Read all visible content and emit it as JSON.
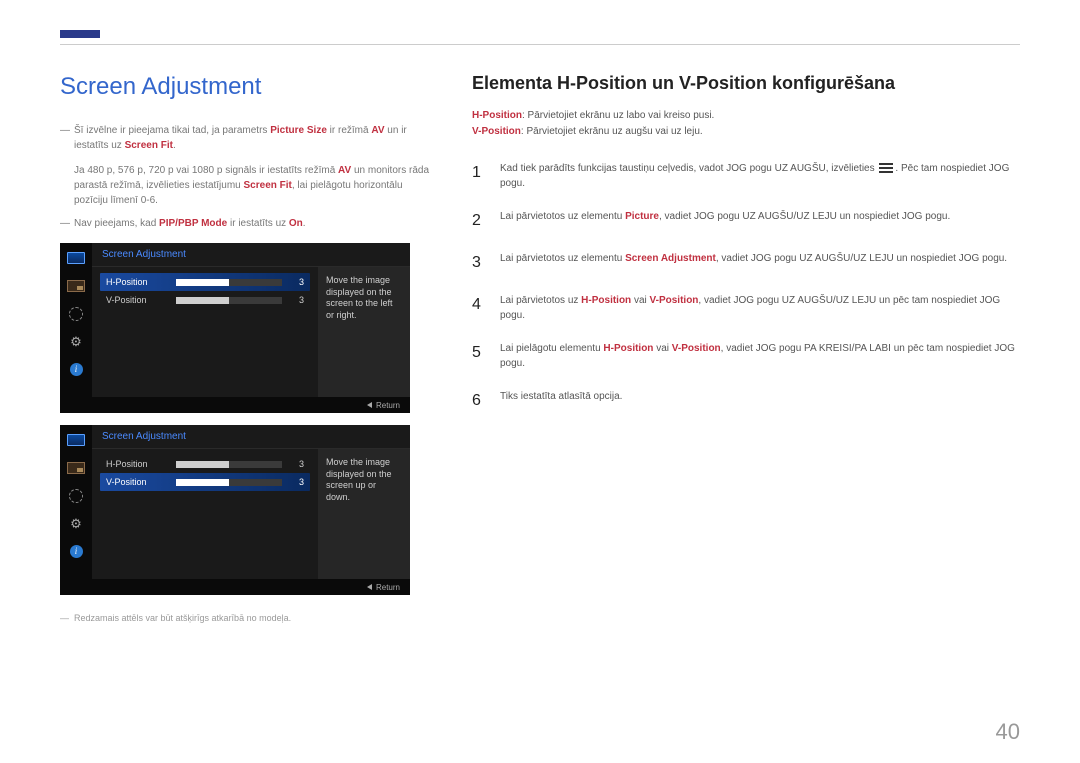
{
  "page_number": "40",
  "left": {
    "title": "Screen Adjustment",
    "note1_pre": "Šī izvēlne ir pieejama tikai tad, ja parametrs ",
    "note1_hl1": "Picture Size",
    "note1_mid": " ir režīmā ",
    "note1_hl2": "AV",
    "note1_mid2": " un ir iestatīts uz ",
    "note1_hl3": "Screen Fit",
    "note1b_pre": "Ja 480 p, 576 p, 720 p vai 1080 p signāls ir iestatīts režīmā ",
    "note1b_hl": "AV",
    "note1b_mid": " un monitors rāda parastā režīmā, izvēlieties iestatījumu ",
    "note1b_hl2": "Screen Fit",
    "note1b_post": ", lai pielāgotu horizontālu pozīciju līmenī 0-6.",
    "note2_pre": "Nav pieejams, kad ",
    "note2_hl": "PIP/PBP Mode",
    "note2_mid": " ir iestatīts uz ",
    "note2_hl2": "On",
    "footnote": "Redzamais attēls var būt atšķirīgs atkarībā no modeļa."
  },
  "osd1": {
    "header": "Screen Adjustment",
    "row1_label": "H-Position",
    "row1_val": "3",
    "row2_label": "V-Position",
    "row2_val": "3",
    "hint": "Move the image displayed on the screen to the left or right.",
    "return": "Return"
  },
  "osd2": {
    "header": "Screen Adjustment",
    "row1_label": "H-Position",
    "row1_val": "3",
    "row2_label": "V-Position",
    "row2_val": "3",
    "hint": "Move the image displayed on the screen up or down.",
    "return": "Return"
  },
  "right": {
    "heading": "Elementa H-Position un V-Position konfigurēšana",
    "desc1_lbl": "H-Position",
    "desc1_txt": ": Pārvietojiet ekrānu uz labo vai kreiso pusi.",
    "desc2_lbl": "V-Position",
    "desc2_txt": ": Pārvietojiet ekrānu uz augšu vai uz leju.",
    "steps": {
      "1_a": "Kad tiek parādīts funkcijas taustiņu ceļvedis, vadot JOG pogu UZ AUGŠU, izvēlieties ",
      "1_c": ". Pēc tam nospiediet JOG pogu.",
      "2_a": "Lai pārvietotos uz elementu ",
      "2_hl": "Picture",
      "2_b": ", vadiet JOG pogu UZ AUGŠU/UZ LEJU un nospiediet JOG pogu.",
      "3_a": "Lai pārvietotos uz elementu ",
      "3_hl": "Screen Adjustment",
      "3_b": ", vadiet JOG pogu UZ AUGŠU/UZ LEJU un nospiediet JOG pogu.",
      "4_a": "Lai pārvietotos uz ",
      "4_hl1": "H-Position",
      "4_m": " vai ",
      "4_hl2": "V-Position",
      "4_b": ", vadiet JOG pogu UZ AUGŠU/UZ LEJU un pēc tam nospiediet JOG pogu.",
      "5_a": "Lai pielāgotu elementu ",
      "5_hl1": "H-Position",
      "5_m": " vai ",
      "5_hl2": "V-Position",
      "5_b": ", vadiet JOG pogu PA KREISI/PA LABI un pēc tam nospiediet JOG pogu.",
      "6": "Tiks iestatīta atlasītā opcija."
    }
  }
}
